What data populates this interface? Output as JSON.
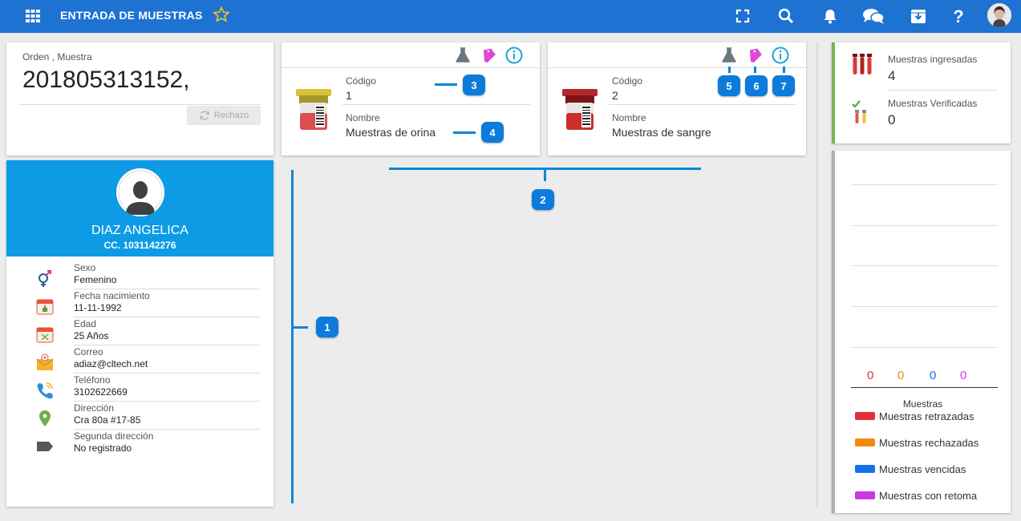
{
  "header": {
    "title": "ENTRADA DE MUESTRAS",
    "icons": [
      "apps-grid-icon",
      "star-icon",
      "fullscreen-icon",
      "search-icon",
      "bell-icon",
      "chat-icon",
      "archive-icon",
      "help-icon",
      "user-avatar"
    ]
  },
  "order": {
    "label": "Orden , Muestra",
    "number": "201805313152,",
    "reject_label": "Rechazo"
  },
  "samples": [
    {
      "code_label": "Código",
      "code": "1",
      "name_label": "Nombre",
      "name": "Muestras de orina",
      "tube_color": "#c23b3b"
    },
    {
      "code_label": "Código",
      "code": "2",
      "name_label": "Nombre",
      "name": "Muestras de sangre",
      "tube_color": "#b01e1e"
    }
  ],
  "patient": {
    "name": "DIAZ ANGELICA",
    "id": "CC. 1031142276",
    "fields": [
      {
        "label": "Sexo",
        "value": "Femenino",
        "icon": "gender-icon"
      },
      {
        "label": "Fecha nacimiento",
        "value": "11-11-1992",
        "icon": "birthday-calendar-icon"
      },
      {
        "label": "Edad",
        "value": "25 Años",
        "icon": "age-calendar-icon"
      },
      {
        "label": "Correo",
        "value": "adiaz@cltech.net",
        "icon": "email-icon"
      },
      {
        "label": "Teléfono",
        "value": "3102622669",
        "icon": "phone-icon"
      },
      {
        "label": "Dirección",
        "value": "Cra 80a #17-85",
        "icon": "location-pin-icon"
      },
      {
        "label": "Segunda dirección",
        "value": "No registrado",
        "icon": "tag-icon"
      }
    ]
  },
  "badges": [
    "1",
    "2",
    "3",
    "4",
    "5",
    "6",
    "7"
  ],
  "stats": {
    "received_label": "Muestras ingresadas",
    "received_value": "4",
    "verified_label": "Muestras Verificadas",
    "verified_value": "0"
  },
  "chart_data": {
    "type": "bar",
    "title": "Muestras",
    "series": [
      {
        "name": "Muestras retrazadas",
        "value": 0,
        "color": "#e0313d"
      },
      {
        "name": "Muestras rechazadas",
        "value": 0,
        "color": "#f5890f"
      },
      {
        "name": "Muestras vencidas",
        "value": 0,
        "color": "#1473e6"
      },
      {
        "name": "Muestras con retoma",
        "value": 0,
        "color": "#c83ae0"
      }
    ],
    "values_text": [
      "0",
      "0",
      "0",
      "0"
    ],
    "legend_placement": "bottom",
    "grid": true
  }
}
